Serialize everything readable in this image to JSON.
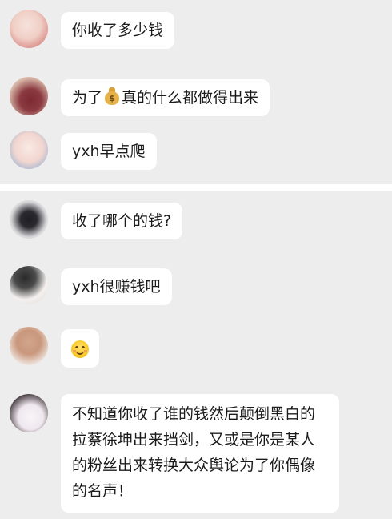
{
  "chat_top": {
    "messages": [
      {
        "text": "你收了多少钱"
      },
      {
        "text_before": "为了",
        "icon": "money-bag-emoji",
        "text_after": "真的什么都做得出来"
      },
      {
        "text": "yxh早点爬"
      }
    ]
  },
  "chat_bottom": {
    "messages": [
      {
        "text": "收了哪个的钱?"
      },
      {
        "text": "yxh很赚钱吧"
      },
      {
        "icon": "smiling-face-emoji"
      },
      {
        "text": "不知道你收了谁的钱然后颠倒黑白的拉蔡徐坤出来挡剑，又或是你是某人的粉丝出来转换大众舆论为了你偶像的名声！"
      }
    ]
  },
  "colors": {
    "background": "#ededed",
    "bubble": "#ffffff",
    "text": "#1b1b1b",
    "divider": "#ffffff"
  }
}
